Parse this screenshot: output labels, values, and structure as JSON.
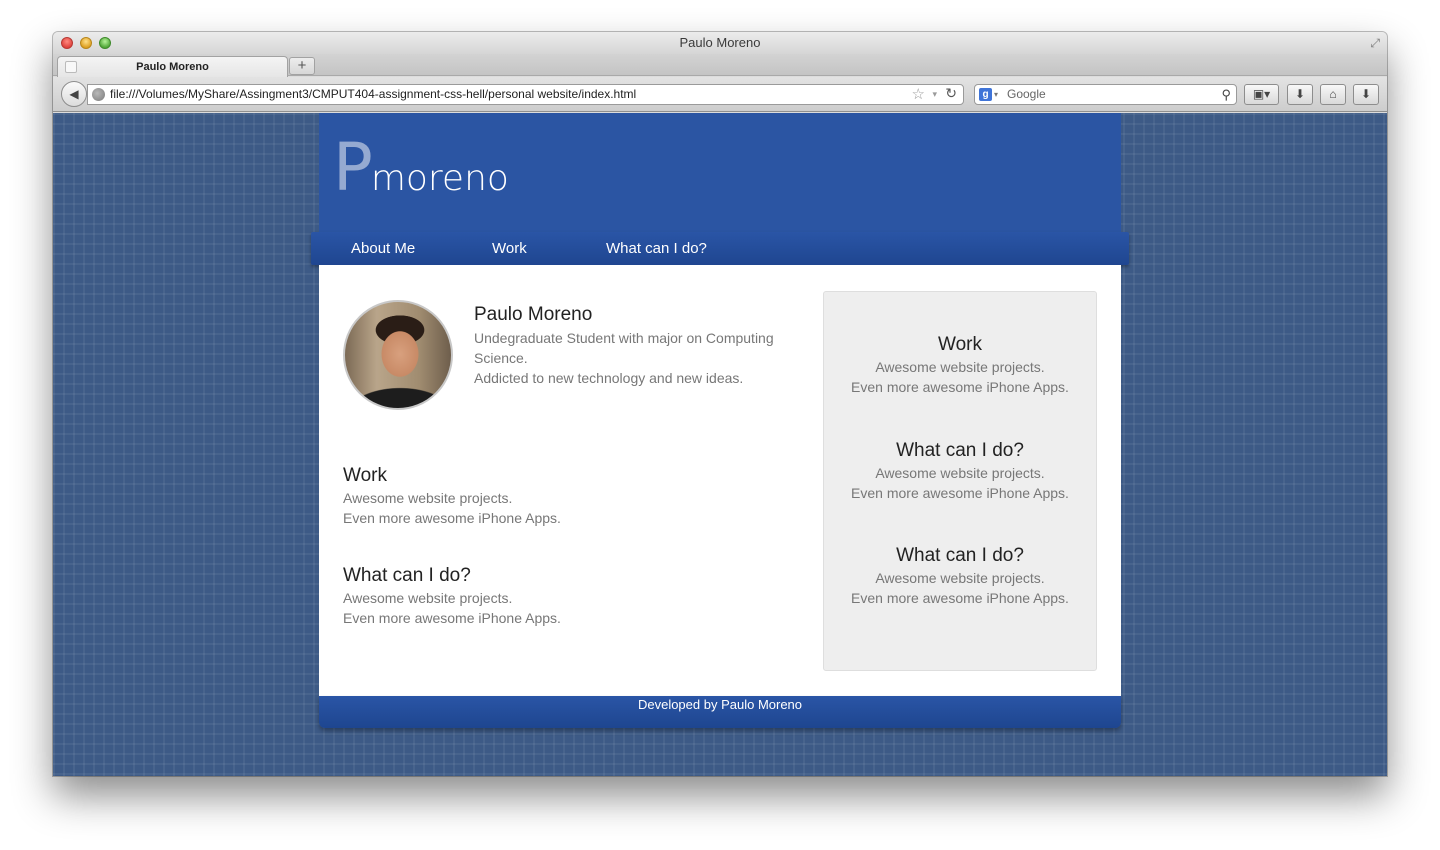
{
  "window": {
    "title": "Paulo Moreno",
    "fullscreen_icon": "⤢"
  },
  "tabs": [
    {
      "label": "Paulo Moreno"
    }
  ],
  "newtab_label": "+",
  "navbar": {
    "back_icon": "◀",
    "url": "file:///Volumes/MyShare/Assingment3/CMPUT404-assignment-css-hell/personal website/index.html",
    "star_icon": "☆",
    "dropmark_icon": "▾",
    "reload_icon": "↻",
    "search_engine_icon": "g",
    "search_drop_icon": "▾",
    "search_placeholder": "Google",
    "magnifier_icon": "⚲",
    "tool_buttons": [
      "▣▾",
      "⬇",
      "⌂",
      "⬇"
    ]
  },
  "site": {
    "logo_initial": "P",
    "logo_rest": "moreno",
    "menu": [
      "About Me",
      "Work",
      "What can I do?"
    ],
    "profile": {
      "name": "Paulo Moreno",
      "line1": "Undegraduate Student with major on Computing",
      "line2": "Science.",
      "line3": "Addicted to new technology and new ideas."
    },
    "main_blocks": [
      {
        "title": "Work",
        "line1": "Awesome website projects.",
        "line2": "Even more awesome iPhone Apps."
      },
      {
        "title": "What can I do?",
        "line1": "Awesome website projects.",
        "line2": "Even more awesome iPhone Apps."
      }
    ],
    "sidebar_blocks": [
      {
        "title": "Work",
        "line1": "Awesome website projects.",
        "line2": "Even more awesome iPhone Apps."
      },
      {
        "title": "What can I do?",
        "line1": "Awesome website projects.",
        "line2": "Even more awesome iPhone Apps."
      },
      {
        "title": "What can I do?",
        "line1": "Awesome website projects.",
        "line2": "Even more awesome iPhone Apps."
      }
    ],
    "footer": "Developed by Paulo Moreno"
  },
  "colors": {
    "page_background": "#3d5a86",
    "brand_blue": "#2b55a3",
    "sidebar_bg": "#eeeeee"
  }
}
